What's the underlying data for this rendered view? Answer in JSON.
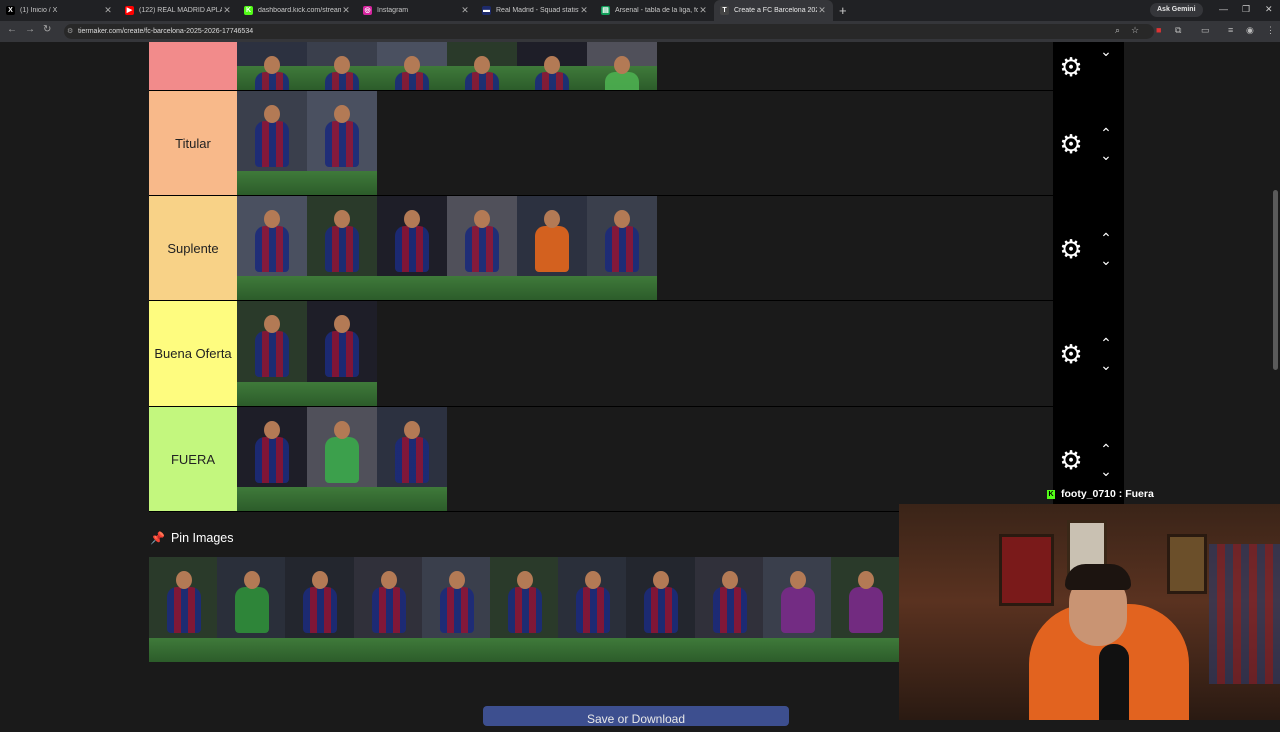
{
  "browser": {
    "tabs": [
      {
        "title": "(1) Inicio / X",
        "favicon": "x-logo",
        "color": "#000000",
        "fav_text": "X"
      },
      {
        "title": "(122) REAL MADRID APLAZA T...",
        "favicon": "youtube-logo",
        "color": "#ff0000",
        "fav_text": "▶"
      },
      {
        "title": "dashboard.kick.com/stream",
        "favicon": "kick-logo",
        "color": "#53fc18",
        "fav_text": "K"
      },
      {
        "title": "Instagram",
        "favicon": "instagram-logo",
        "color": "#d6249f",
        "fav_text": "◎"
      },
      {
        "title": "Real Madrid - Squad statistics |",
        "favicon": "fotmob-logo",
        "color": "#1d2a6b",
        "fav_text": "▬"
      },
      {
        "title": "Arsenal - tabla de la liga, forma...",
        "favicon": "sheets-logo",
        "color": "#0f9d58",
        "fav_text": "▤"
      },
      {
        "title": "Create a FC Barcelona 2025-20...",
        "favicon": "tiermaker-logo",
        "color": "#444444",
        "fav_text": "T"
      }
    ],
    "active_tab": 6,
    "ask_gemini": "Ask Gemini",
    "url": "tiermaker.com/create/fc-barcelona-2025-2026-17746534"
  },
  "tiers": [
    {
      "label": "",
      "color": "#f28b8b",
      "count": 6,
      "partial": true
    },
    {
      "label": "Titular",
      "color": "#f8b98a",
      "count": 2
    },
    {
      "label": "Suplente",
      "color": "#f8d287",
      "count": 6
    },
    {
      "label": "Buena Oferta",
      "color": "#fefc7f",
      "count": 2
    },
    {
      "label": "FUERA",
      "color": "#c3f77e",
      "count": 3
    }
  ],
  "pin_images": {
    "title": "Pin Images",
    "count": 11
  },
  "save_button": "Save or Download",
  "chat": {
    "user": "footy_0710",
    "separator": " : ",
    "message": "Fuera"
  }
}
